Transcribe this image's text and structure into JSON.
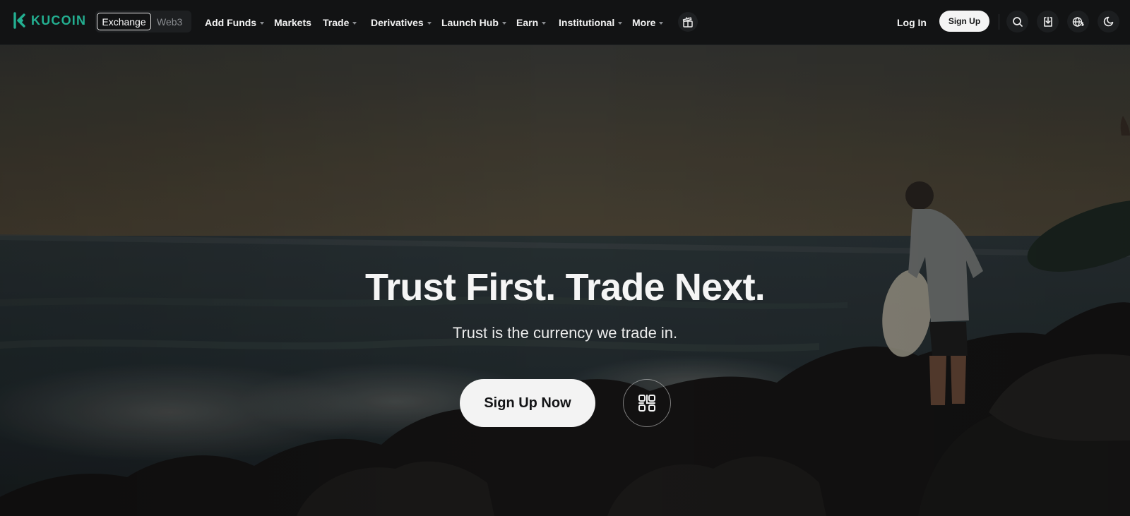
{
  "brand": {
    "name": "KUCOIN",
    "color": "#23af91"
  },
  "switch": {
    "exchange": "Exchange",
    "web3": "Web3"
  },
  "nav": {
    "add_funds": "Add Funds",
    "markets": "Markets",
    "trade": "Trade",
    "derivatives": "Derivatives",
    "launch_hub": "Launch Hub",
    "earn": "Earn",
    "institutional": "Institutional",
    "more": "More"
  },
  "auth": {
    "login": "Log In",
    "signup": "Sign Up"
  },
  "icons": {
    "gift": "gift-icon",
    "search": "search-icon",
    "download": "download-icon",
    "language": "globe-currency-icon",
    "theme": "moon-icon",
    "qr": "qr-code-icon"
  },
  "hero": {
    "title": "Trust First. Trade Next.",
    "subtitle": "Trust is the currency we trade in.",
    "cta": "Sign Up Now"
  }
}
